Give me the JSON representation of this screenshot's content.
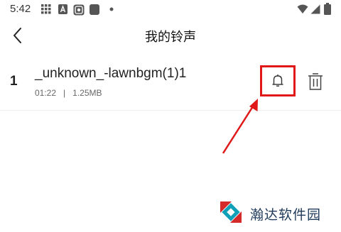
{
  "status_bar": {
    "time": "5:42",
    "left_icons": [
      "grid-icon",
      "text-a-icon",
      "camera-box-icon",
      "app-square-icon",
      "dot-icon"
    ],
    "right_icons": [
      "wifi-icon",
      "signal-icon",
      "battery-icon"
    ]
  },
  "header": {
    "title": "我的铃声",
    "back_icon": "chevron-left-icon"
  },
  "ringtones": [
    {
      "index": "1",
      "name": "_unknown_-lawnbgm(1)1",
      "duration": "01:22",
      "separator": "|",
      "size": "1.25MB"
    }
  ],
  "actions": {
    "set_icon": "bell-icon",
    "delete_icon": "trash-icon"
  },
  "annotation": {
    "highlight_color": "#e01818"
  },
  "watermark": {
    "text": "瀚达软件园"
  }
}
